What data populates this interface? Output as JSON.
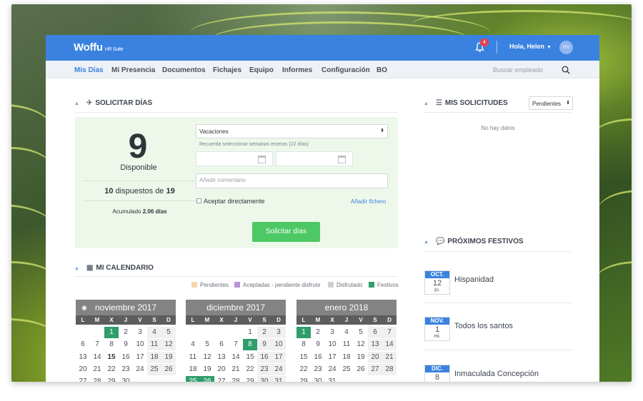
{
  "app": {
    "brand": "Woffu",
    "brand_sub": "HR Suite",
    "notifications": "4",
    "greeting": "Hola, Helen",
    "avatar": "HV"
  },
  "nav": {
    "items": [
      "Mis Días",
      "Mi Presencia",
      "Documentos",
      "Fichajes",
      "Equipo",
      "Informes",
      "Configuración",
      "BO"
    ],
    "search_placeholder": "Buscar empleado"
  },
  "solicitar": {
    "title": "SOLICITAR DÍAS",
    "available_value": "9",
    "available_label": "Disponible",
    "used": "10",
    "used_mid": "dispuestos de",
    "total": "19",
    "accum_label": "Acumulado",
    "accum_value": "2.06 días",
    "type_value": "Vacaciones",
    "hint": "Recuerda seleccionar semanas enteras (22 días)",
    "comment_placeholder": "Añadir comentario",
    "accept_label": "Aceptar directamente",
    "attach_label": "Añadir fichero",
    "submit_label": "Solicitar días"
  },
  "requests": {
    "title": "MIS SOLICITUDES",
    "filter": "Pendientes",
    "empty": "No hay datos"
  },
  "calendar": {
    "title": "MI CALENDARIO",
    "legend": [
      {
        "label": "Pendientes",
        "color": "#f6d6a6"
      },
      {
        "label": "Aceptadas - pendiente disfrute",
        "color": "#b795d2"
      },
      {
        "label": "Disfrutado",
        "color": "#cfcfcf"
      },
      {
        "label": "Festivos",
        "color": "#2f9e6a"
      }
    ],
    "weekdays": [
      "L",
      "M",
      "X",
      "J",
      "V",
      "S",
      "D"
    ],
    "months": [
      {
        "name": "noviembre 2017",
        "start": 2,
        "days": 30,
        "fest": [
          1
        ],
        "bold": [
          15
        ]
      },
      {
        "name": "diciembre 2017",
        "start": 4,
        "days": 31,
        "fest": [
          8,
          25,
          26
        ],
        "bold": []
      },
      {
        "name": "enero 2018",
        "start": 0,
        "days": 31,
        "fest": [
          1
        ],
        "bold": []
      }
    ]
  },
  "holidays": {
    "title": "PRÓXIMOS FESTIVOS",
    "items": [
      {
        "month": "OCT.",
        "day": "12",
        "weekday": "ju.",
        "name": "Hispanidad"
      },
      {
        "month": "NOV.",
        "day": "1",
        "weekday": "mi.",
        "name": "Todos los santos"
      },
      {
        "month": "DIC.",
        "day": "8",
        "weekday": "",
        "name": "Inmaculada Concepción"
      }
    ]
  }
}
